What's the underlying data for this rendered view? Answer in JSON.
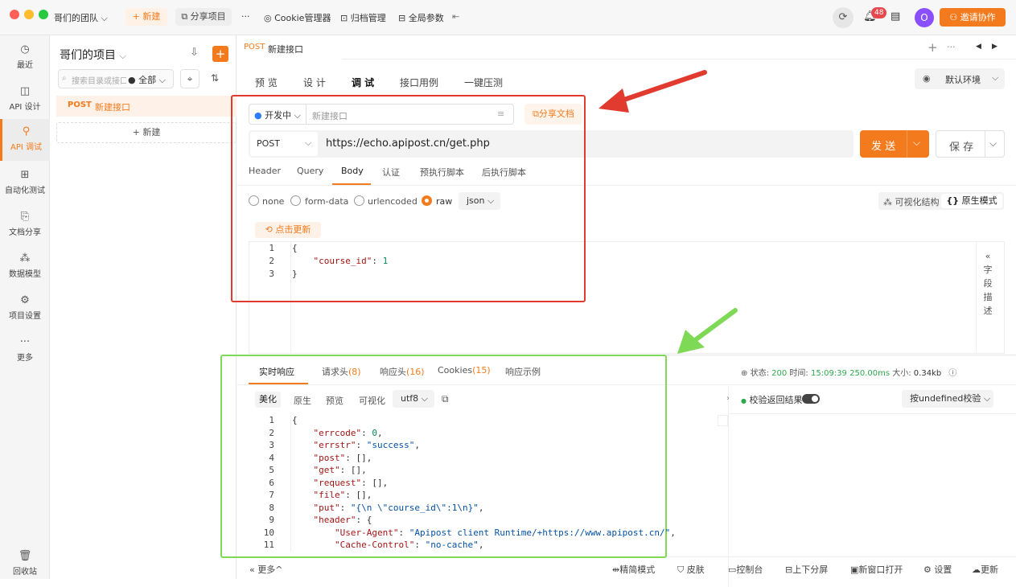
{
  "titlebar": {
    "team": "哥们的团队",
    "new_label": "+ 新建",
    "share_project": "分享项目",
    "more": "···",
    "cookie_manager": "Cookie管理器",
    "archive": "归档管理",
    "global_params": "全局参数",
    "notification_count": "48",
    "invite": "邀请协作",
    "avatar_initial": "O"
  },
  "nav": {
    "items": [
      {
        "label": "最近",
        "icon": "clock-icon"
      },
      {
        "label": "API 设计",
        "icon": "design-icon"
      },
      {
        "label": "API 调试",
        "icon": "debug-icon"
      },
      {
        "label": "自动化测试",
        "icon": "automation-icon"
      },
      {
        "label": "文档分享",
        "icon": "doc-share-icon"
      },
      {
        "label": "数据模型",
        "icon": "data-model-icon"
      },
      {
        "label": "项目设置",
        "icon": "settings-icon"
      },
      {
        "label": "更多",
        "icon": "more-icon"
      }
    ],
    "trash": "回收站"
  },
  "project": {
    "title": "哥们的项目",
    "search_placeholder": "搜索目录或接口",
    "filter": "全部",
    "item_method": "POST",
    "item_name": "新建接口",
    "new_label": "+ 新建"
  },
  "tab": {
    "method": "POST",
    "name": "新建接口"
  },
  "subtabs": [
    "预 览",
    "设 计",
    "调 试",
    "接口用例",
    "一键压测"
  ],
  "env": "默认环境",
  "request": {
    "status": "开发中",
    "name_placeholder": "新建接口",
    "share_doc": "分享文档",
    "method": "POST",
    "url": "https://echo.apipost.cn/get.php",
    "send": "发 送",
    "save": "保 存",
    "param_tabs": [
      "Header",
      "Query",
      "Body",
      "认证",
      "预执行脚本",
      "后执行脚本"
    ],
    "body_types": [
      "none",
      "form-data",
      "urlencoded",
      "raw"
    ],
    "raw_format": "json",
    "visual_mode": "可视化结构",
    "raw_mode": "原生模式",
    "refresh": "点击更新",
    "code": [
      {
        "n": "1",
        "text": "{"
      },
      {
        "n": "2",
        "key": "\"course_id\"",
        "val": "1"
      },
      {
        "n": "3",
        "text": "}"
      }
    ],
    "field_desc": [
      "字",
      "段",
      "描",
      "述"
    ]
  },
  "response": {
    "tabs": [
      "实时响应",
      "请求头",
      "响应头",
      "Cookies",
      "响应示例"
    ],
    "tab_counts": [
      "",
      "(8)",
      "(16)",
      "(15)",
      ""
    ],
    "status_label": "状态:",
    "status": "200",
    "time_label": "时间:",
    "time": "15:09:39",
    "duration": "250.00ms",
    "size_label": "大小:",
    "size": "0.34kb",
    "view_modes": [
      "美化",
      "原生",
      "预览",
      "可视化"
    ],
    "encoding": "utf8",
    "validate_label": "校验返回结果",
    "validate_select": "按undefined校验",
    "code": [
      {
        "n": "1",
        "text": "{"
      },
      {
        "n": "2",
        "key": "\"errcode\"",
        "val": "0",
        "type": "num"
      },
      {
        "n": "3",
        "key": "\"errstr\"",
        "val": "\"success\"",
        "type": "str"
      },
      {
        "n": "4",
        "key": "\"post\"",
        "val": "[]",
        "type": "pun"
      },
      {
        "n": "5",
        "key": "\"get\"",
        "val": "[]",
        "type": "pun"
      },
      {
        "n": "6",
        "key": "\"request\"",
        "val": "[]",
        "type": "pun"
      },
      {
        "n": "7",
        "key": "\"file\"",
        "val": "[]",
        "type": "pun"
      },
      {
        "n": "8",
        "key": "\"put\"",
        "val": "\"{\\n \\\"course_id\\\":1\\n}\"",
        "type": "str"
      },
      {
        "n": "9",
        "key": "\"header\"",
        "val": "{",
        "type": "pun",
        "nocomma": true
      },
      {
        "n": "10",
        "key": "\"User-Agent\"",
        "val": "\"Apipost client Runtime/+https://www.apipost.cn/\"",
        "type": "str",
        "indent": 2
      },
      {
        "n": "11",
        "key": "\"Cache-Control\"",
        "val": "\"no-cache\"",
        "type": "str",
        "indent": 2
      }
    ]
  },
  "bottombar": {
    "more": "更多",
    "items": [
      "精简模式",
      "皮肤",
      "控制台",
      "上下分屏",
      "新窗口打开",
      "设置",
      "更新"
    ]
  }
}
